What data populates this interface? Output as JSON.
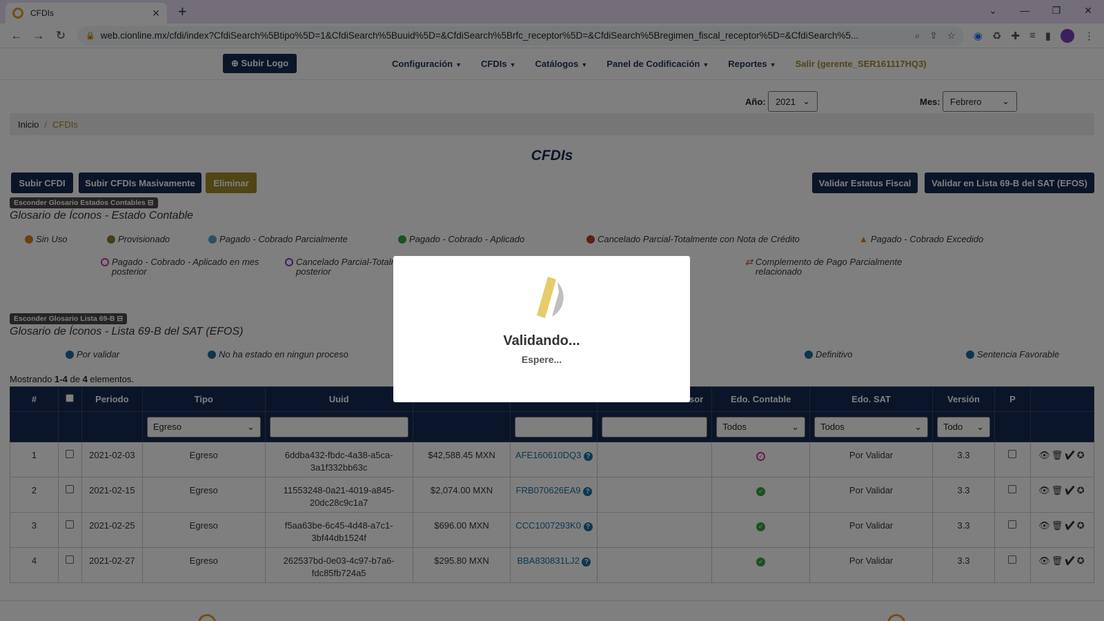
{
  "browser": {
    "tab_title": "CFDIs",
    "url": "web.cionline.mx/cfdi/index?CfdiSearch%5Btipo%5D=1&CfdiSearch%5Buuid%5D=&CfdiSearch%5Brfc_receptor%5D=&CfdiSearch%5Bregimen_fiscal_receptor%5D=&CfdiSearch%5..."
  },
  "nav": {
    "logo_button": "Subir Logo",
    "menu": [
      "Configuración",
      "CFDIs",
      "Catálogos",
      "Panel de Codificación",
      "Reportes"
    ],
    "logout": "Salir (gerente_SER161117HQ3)"
  },
  "filters": {
    "year_label": "Año:",
    "year_value": "2021",
    "month_label": "Mes:",
    "month_value": "Febrero"
  },
  "breadcrumb": {
    "home": "Inicio",
    "current": "CFDIs"
  },
  "page_title": "CFDIs",
  "actions": {
    "upload": "Subir CFDI",
    "bulk_upload": "Subir CFDIs Masivamente",
    "delete": "Eliminar",
    "validate_status": "Validar Estatus Fiscal",
    "validate_69b": "Validar en Lista 69-B del SAT (EFOS)"
  },
  "glossary1": {
    "toggle": "Esconder Glosario Estados Contables",
    "title": "Glosario de Íconos - Estado Contable",
    "items": [
      "Sin Uso",
      "Provisionado",
      "Pagado - Cobrado Parcialmente",
      "Pagado - Cobrado - Aplicado",
      "Cancelado Parcial-Totalmente con Nota de Crédito",
      "Pagado - Cobrado Excedido",
      "Pagado - Cobrado - Aplicado en mes posterior",
      "Cancelado Parcial-Totalr posterior",
      "Complemento de Pago Parcialmente relacionado"
    ]
  },
  "glossary2": {
    "toggle": "Esconder Glosario Lista 69-B",
    "title": "Glosario de Íconos - Lista 69-B del SAT (EFOS)",
    "items": [
      "Por validar",
      "No ha estado en ningun proceso",
      "Definitivo",
      "Sentencia Favorable"
    ]
  },
  "showing": {
    "prefix": "Mostrando",
    "range": "1-4",
    "mid": "de",
    "total": "4",
    "suffix": "elementos."
  },
  "table": {
    "headers": [
      "#",
      "",
      "Periodo",
      "Tipo",
      "Uuid",
      "",
      "",
      "g",
      "sor",
      "Edo. Contable",
      "Edo. SAT",
      "Versión",
      "P",
      ""
    ],
    "filters": {
      "tipo": "Egreso",
      "edo_contable": "Todos",
      "edo_sat": "Todos",
      "version": "Todo"
    },
    "rows": [
      {
        "n": "1",
        "periodo": "2021-02-03",
        "tipo": "Egreso",
        "uuid1": "6ddba432-fbdc-4a38-a5ca-",
        "uuid2": "3a1f332bb63c",
        "monto": "$42,588.45 MXN",
        "rfc": "AFE160610DQ3",
        "edo_contable": "posterior",
        "edo_sat": "Por Validar",
        "version": "3.3"
      },
      {
        "n": "2",
        "periodo": "2021-02-15",
        "tipo": "Egreso",
        "uuid1": "11553248-0a21-4019-a845-",
        "uuid2": "20dc28c9c1a7",
        "monto": "$2,074.00 MXN",
        "rfc": "FRB070626EA9",
        "edo_contable": "aplicado",
        "edo_sat": "Por Validar",
        "version": "3.3"
      },
      {
        "n": "3",
        "periodo": "2021-02-25",
        "tipo": "Egreso",
        "uuid1": "f5aa63be-6c45-4d48-a7c1-",
        "uuid2": "3bf44db1524f",
        "monto": "$696.00 MXN",
        "rfc": "CCC1007293K0",
        "edo_contable": "aplicado",
        "edo_sat": "Por Validar",
        "version": "3.3"
      },
      {
        "n": "4",
        "periodo": "2021-02-27",
        "tipo": "Egreso",
        "uuid1": "262537bd-0e03-4c97-b7a6-",
        "uuid2": "fdc85fb724a5",
        "monto": "$295.80 MXN",
        "rfc": "BBA830831LJ2",
        "edo_contable": "aplicado",
        "edo_sat": "Por Validar",
        "version": "3.3"
      }
    ]
  },
  "modal": {
    "title": "Validando...",
    "subtitle": "Espere..."
  },
  "colors": {
    "primary": "#172b53",
    "gold": "#a18a2b",
    "link": "#1a6fa0",
    "ok": "#3aa142"
  }
}
